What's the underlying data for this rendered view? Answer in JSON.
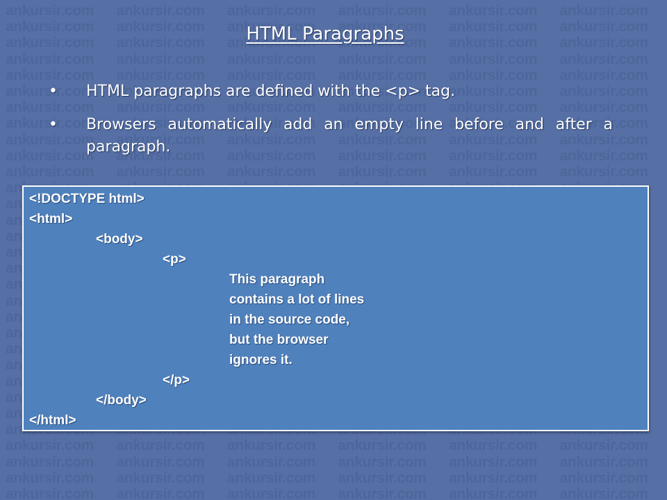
{
  "watermark": {
    "text": "ankursir.com"
  },
  "slide": {
    "title": "HTML Paragraphs",
    "bullets": [
      {
        "mark": "•",
        "text": "HTML paragraphs are defined with the <p> tag."
      },
      {
        "mark": "•",
        "text": "Browsers automatically add an empty line before and after a paragraph."
      }
    ]
  },
  "code": {
    "lines": [
      {
        "text": "<!DOCTYPE html>",
        "indent": 0
      },
      {
        "text": "<html>",
        "indent": 0
      },
      {
        "text": "<body>",
        "indent": 1
      },
      {
        "text": "<p>",
        "indent": 2
      },
      {
        "text": "This paragraph",
        "indent": 3
      },
      {
        "text": "contains a lot of lines",
        "indent": 3
      },
      {
        "text": "in the source code,",
        "indent": 3
      },
      {
        "text": "but the browser",
        "indent": 3
      },
      {
        "text": "ignores it.",
        "indent": 3
      },
      {
        "text": "</p>",
        "indent": 2
      },
      {
        "text": "</body>",
        "indent": 1
      },
      {
        "text": "</html>",
        "indent": 0
      }
    ]
  }
}
